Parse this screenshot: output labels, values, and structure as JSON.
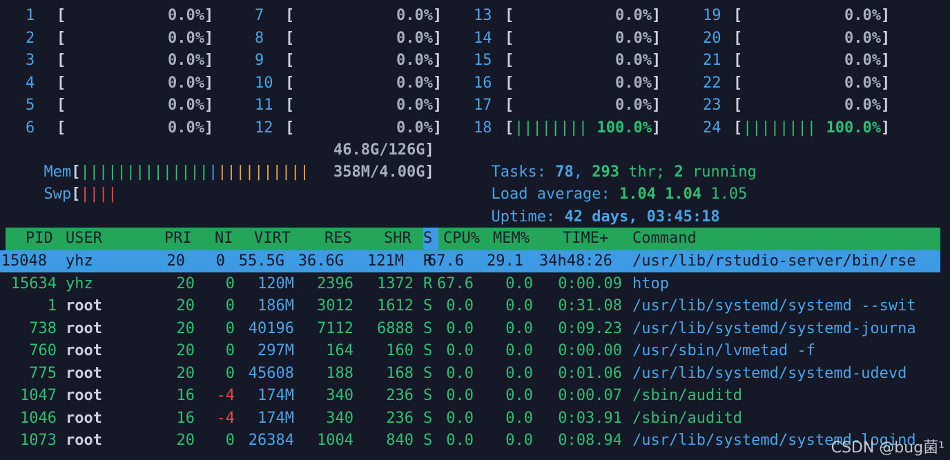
{
  "cpus": [
    {
      "id": "1",
      "pct": "0.0%"
    },
    {
      "id": "2",
      "pct": "0.0%"
    },
    {
      "id": "3",
      "pct": "0.0%"
    },
    {
      "id": "4",
      "pct": "0.0%"
    },
    {
      "id": "5",
      "pct": "0.0%"
    },
    {
      "id": "6",
      "pct": "0.0%"
    },
    {
      "id": "7",
      "pct": "0.0%"
    },
    {
      "id": "8",
      "pct": "0.0%"
    },
    {
      "id": "9",
      "pct": "0.0%"
    },
    {
      "id": "10",
      "pct": "0.0%"
    },
    {
      "id": "11",
      "pct": "0.0%"
    },
    {
      "id": "12",
      "pct": "0.0%"
    },
    {
      "id": "13",
      "pct": "0.0%"
    },
    {
      "id": "14",
      "pct": "0.0%"
    },
    {
      "id": "15",
      "pct": "0.0%"
    },
    {
      "id": "16",
      "pct": "0.0%"
    },
    {
      "id": "17",
      "pct": "0.0%"
    },
    {
      "id": "18",
      "pct": "100.0%",
      "bar": "||||||||"
    },
    {
      "id": "19",
      "pct": "0.0%"
    },
    {
      "id": "20",
      "pct": "0.0%"
    },
    {
      "id": "21",
      "pct": "0.0%"
    },
    {
      "id": "22",
      "pct": "0.0%"
    },
    {
      "id": "23",
      "pct": "0.0%"
    },
    {
      "id": "24",
      "pct": "100.0%",
      "bar": "||||||||"
    }
  ],
  "mem": {
    "label": "Mem",
    "bar_green": "||||||||||||||",
    "bar_blue": "|",
    "bar_orange": "||||||||||",
    "value": "46.8G/126G"
  },
  "swp": {
    "label": "Swp",
    "bar_red": "||||",
    "value": "358M/4.00G"
  },
  "tasks": {
    "label": "Tasks:",
    "count": "78",
    "sep1": ",",
    "thr": "293",
    "thr_label": "thr;",
    "running": "2",
    "running_label": "running"
  },
  "load": {
    "label": "Load average:",
    "v1": "1.04",
    "v2": "1.04",
    "v3": "1.05"
  },
  "uptime": {
    "label": "Uptime:",
    "value": "42 days, 03:45:18"
  },
  "columns": {
    "pid": "PID",
    "user": "USER",
    "pri": "PRI",
    "ni": "NI",
    "virt": "VIRT",
    "res": "RES",
    "shr": "SHR",
    "s": "S",
    "cpu": "CPU%",
    "mem": "MEM%",
    "time": "TIME+",
    "command": "Command"
  },
  "processes": [
    {
      "pid": "15048",
      "user": "yhz",
      "pri": "20",
      "ni": "0",
      "virt": "55.5G",
      "res": "36.6G",
      "shr": "121M",
      "s": "R",
      "cpu": "67.6",
      "mem": "29.1",
      "time": "34h48:26",
      "command": "/usr/lib/rstudio-server/bin/rse"
    },
    {
      "pid": "15634",
      "user": "yhz",
      "pri": "20",
      "ni": "0",
      "virt": "120M",
      "res": "2396",
      "shr": "1372",
      "s": "R",
      "cpu": "67.6",
      "mem": "0.0",
      "time": "0:00.09",
      "command": "htop"
    },
    {
      "pid": "1",
      "user": "root",
      "pri": "20",
      "ni": "0",
      "virt": "186M",
      "res": "3012",
      "shr": "1612",
      "s": "S",
      "cpu": "0.0",
      "mem": "0.0",
      "time": "0:31.08",
      "command": "/usr/lib/systemd/systemd --swit"
    },
    {
      "pid": "738",
      "user": "root",
      "pri": "20",
      "ni": "0",
      "virt": "40196",
      "res": "7112",
      "shr": "6888",
      "s": "S",
      "cpu": "0.0",
      "mem": "0.0",
      "time": "0:09.23",
      "command": "/usr/lib/systemd/systemd-journa"
    },
    {
      "pid": "760",
      "user": "root",
      "pri": "20",
      "ni": "0",
      "virt": "297M",
      "res": "164",
      "shr": "160",
      "s": "S",
      "cpu": "0.0",
      "mem": "0.0",
      "time": "0:00.00",
      "command": "/usr/sbin/lvmetad -f"
    },
    {
      "pid": "775",
      "user": "root",
      "pri": "20",
      "ni": "0",
      "virt": "45608",
      "res": "188",
      "shr": "168",
      "s": "S",
      "cpu": "0.0",
      "mem": "0.0",
      "time": "0:01.06",
      "command": "/usr/lib/systemd/systemd-udevd"
    },
    {
      "pid": "1047",
      "user": "root",
      "pri": "16",
      "ni": "-4",
      "virt": "174M",
      "res": "340",
      "shr": "236",
      "s": "S",
      "cpu": "0.0",
      "mem": "0.0",
      "time": "0:00.07",
      "command": "/sbin/auditd"
    },
    {
      "pid": "1046",
      "user": "root",
      "pri": "16",
      "ni": "-4",
      "virt": "174M",
      "res": "340",
      "shr": "236",
      "s": "S",
      "cpu": "0.0",
      "mem": "0.0",
      "time": "0:03.91",
      "command": "/sbin/auditd"
    },
    {
      "pid": "1073",
      "user": "root",
      "pri": "20",
      "ni": "0",
      "virt": "26384",
      "res": "1004",
      "shr": "840",
      "s": "S",
      "cpu": "0.0",
      "mem": "0.0",
      "time": "0:08.94",
      "command": "/usr/lib/systemd/systemd-logind"
    }
  ],
  "watermark": "CSDN @bug菌¹"
}
